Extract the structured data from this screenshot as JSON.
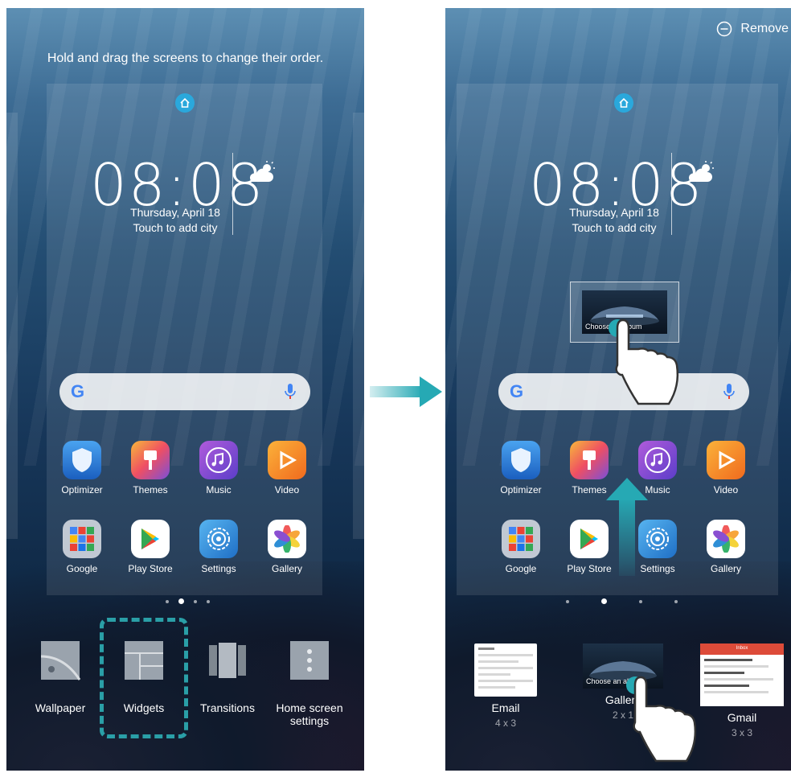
{
  "left_screen": {
    "hint": "Hold and drag the screens to change their order.",
    "clock": {
      "time": "08:08",
      "date": "Thursday, April 18",
      "city": "Touch to add city"
    },
    "apps_row1": [
      {
        "label": "Optimizer",
        "icon": "shield-icon",
        "color": "#2f7ad6"
      },
      {
        "label": "Themes",
        "icon": "brush-icon",
        "color": "#f06a38"
      },
      {
        "label": "Music",
        "icon": "music-note-icon",
        "color": "#7b4fcf"
      },
      {
        "label": "Video",
        "icon": "play-icon",
        "color": "#f59a1b"
      }
    ],
    "apps_row2": [
      {
        "label": "Google",
        "icon": "folder-icon",
        "color": "#c9ccd4"
      },
      {
        "label": "Play Store",
        "icon": "play-store-icon",
        "color": "#ffffff"
      },
      {
        "label": "Settings",
        "icon": "gear-icon",
        "color": "#2f8fd6"
      },
      {
        "label": "Gallery",
        "icon": "flower-icon",
        "color": "#ffffff"
      }
    ],
    "options": [
      {
        "label": "Wallpaper",
        "icon": "wallpaper-icon"
      },
      {
        "label": "Widgets",
        "icon": "widgets-icon"
      },
      {
        "label": "Transitions",
        "icon": "transitions-icon"
      },
      {
        "label": "Home screen settings",
        "icon": "home-settings-icon"
      }
    ]
  },
  "right_screen": {
    "remove_label": "Remove",
    "clock": {
      "time": "08:08",
      "date": "Thursday, April 18",
      "city": "Touch to add city"
    },
    "drag_widget_text": "Choose an album",
    "apps_row1": [
      {
        "label": "Optimizer",
        "icon": "shield-icon"
      },
      {
        "label": "Themes",
        "icon": "brush-icon"
      },
      {
        "label": "Music",
        "icon": "music-note-icon"
      },
      {
        "label": "Video",
        "icon": "play-icon"
      }
    ],
    "apps_row2": [
      {
        "label": "Google",
        "icon": "folder-icon"
      },
      {
        "label": "Play Store",
        "icon": "play-store-icon"
      },
      {
        "label": "Settings",
        "icon": "gear-icon"
      },
      {
        "label": "Gallery",
        "icon": "flower-icon"
      }
    ],
    "widgets": [
      {
        "name": "Email",
        "size": "4 x 3"
      },
      {
        "name": "Gallery",
        "size": "2 x 1",
        "preview_text": "Choose an album"
      },
      {
        "name": "Gmail",
        "size": "3 x 3",
        "preview_header": "Inbox"
      }
    ]
  },
  "colors": {
    "accent": "#2aa8dc",
    "selection": "#2a9fa7",
    "arrow": "#26a9b4"
  }
}
